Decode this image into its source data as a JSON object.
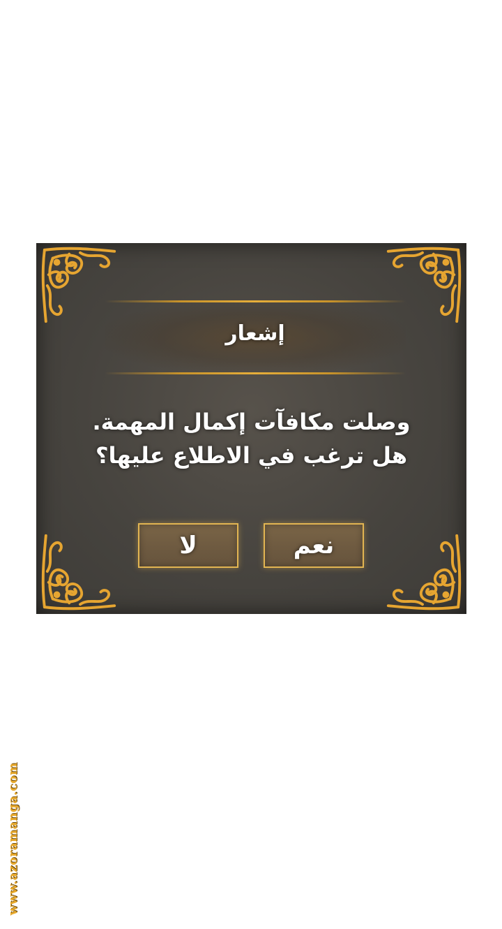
{
  "dialog": {
    "title": "إشعار",
    "message": "وصلت مكافآت إكمال المهمة. هل ترغب في الاطلاع عليها؟",
    "buttons": {
      "yes_label": "نعم",
      "no_label": "لا"
    }
  },
  "watermark": {
    "text": "www.azoramanga.com"
  },
  "colors": {
    "panel": "#47443f",
    "gold": "#e2b552",
    "ornament": "#e6a531"
  }
}
